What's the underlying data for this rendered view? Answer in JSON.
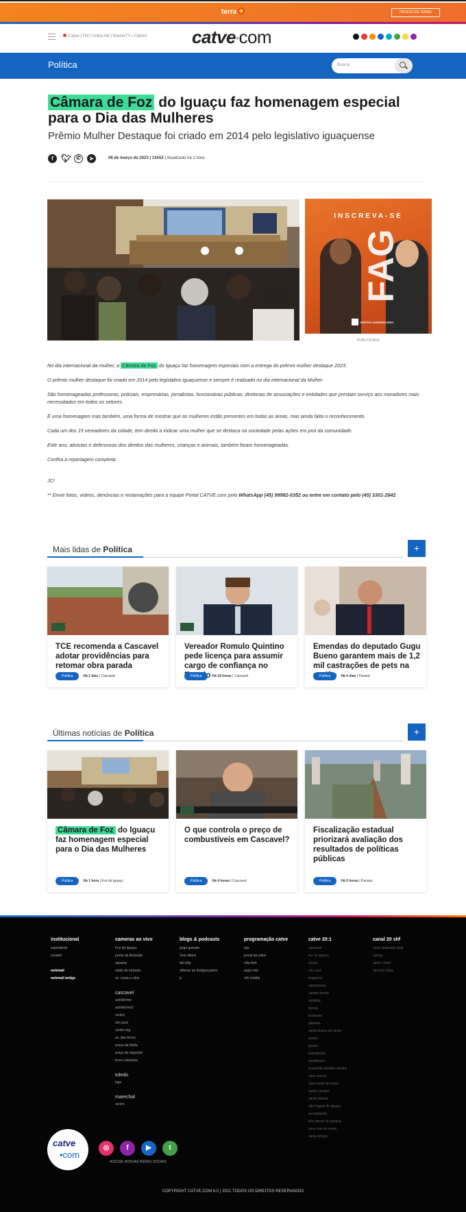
{
  "terra": {
    "logo": "terra",
    "button": "PRODUTOS TERRA"
  },
  "header": {
    "nav_links": "Catve | FM | Unika AM | MasterTV | Catve2",
    "brand_main": "catve",
    "brand_dot": "◦",
    "brand_com": "com",
    "dot_colors": [
      "#111111",
      "#e53935",
      "#fb8c00",
      "#1565c0",
      "#00acc1",
      "#43a047",
      "#fdd835",
      "#8e24aa"
    ]
  },
  "section": {
    "title": "Política",
    "search_placeholder": "Busca"
  },
  "article": {
    "title_hl": "Câmara de Foz",
    "title_rest": " do Iguaçu faz homenagem especial para o Dia das Mulheres",
    "subtitle": "Prêmio Mulher Destaque foi criado em 2014 pelo legislativo iguaçuense",
    "date": "08 de março de 2023 | 13h53",
    "updated": " | Atualizado há 1 hora",
    "share_icons": [
      "facebook-icon",
      "twitter-icon",
      "whatsapp-icon",
      "telegram-icon"
    ]
  },
  "ad": {
    "title": "INSCREVA-SE",
    "big": "FAG",
    "badge": "CENTRO UNIVERSITÁRIO",
    "label": "PUBLICIDADE"
  },
  "body": {
    "p1_pre": "No dia internacional da mulher, a ",
    "p1_hl": "Câmara de Foz",
    "p1_post": " do Iguaçu faz homenagem especiais com a entrega do prêmio mulher destaque 2023.",
    "p2": "O prêmio mulher destaque foi criado em 2014 pelo legislativo iguaçuense e sempre é realizado no dia internacional da Mulher.",
    "p3": "São homenageadas professoras, policiais, empresárias, jornalistas, funcionárias públicas, diretorias de associações e entidades que prestam serviço aos moradores mais necessitados em todos os setores.",
    "p4": "É uma homenagem mas também, uma forma de mostrar que as mulheres estão presentes em todas as áreas, mas ainda falta o reconhecimento.",
    "p5": "Cada um dos 15 vereadores da cidade, tem direito a indicar uma mulher que se destaca na sociedade pelas ações em prol da comunidade.",
    "p6": "Este ano, ativistas e defensoras dos direitos das mulheres, crianças e animais, também foram homenageadas.",
    "p7": "Confira a reportagem completa:",
    "p8": "JC!",
    "p9_pre": "** Envie fotos, vídeos, denúncias e reclamações para a equipe Portal CATVE.com pelo ",
    "p9_strong": "WhatsApp (45) 99982-0352 ou entre em contato pelo (45) 3301-2642"
  },
  "mais_lidas": {
    "label_pre": "Mais lidas de ",
    "label_bold": "Política",
    "plus": "+",
    "cards": [
      {
        "title": "TCE recomenda a Cascavel adotar providências para retomar obra parada",
        "pill": "Política",
        "time": "Há 2 dias",
        "place": " | Cascavel"
      },
      {
        "title": "Vereador Romulo Quintino pede licença para assumir cargo de confiança no Estado",
        "pill": "Política",
        "time": "Há 18 horas",
        "place": " | Cascavel"
      },
      {
        "title": "Emendas do deputado Gugu Bueno garantem mais de 1,2 mil castrações de pets na região",
        "pill": "Política",
        "time": "Há 4 dias",
        "place": " | Paraná"
      }
    ]
  },
  "ultimas": {
    "label_pre": "Últimas notícias de ",
    "label_bold": "Política",
    "plus": "+",
    "cards": [
      {
        "title_hl": "Câmara de Foz",
        "title": " do Iguaçu faz homenagem especial para o Dia das Mulheres",
        "pill": "Política",
        "time": "Há 1 hora",
        "place": " | Foz do Iguaçu"
      },
      {
        "title": "O que controla o preço de combustíveis em Cascavel?",
        "pill": "Política",
        "time": "Há 4 horas",
        "place": " | Cascavel"
      },
      {
        "title": "Fiscalização estadual priorizará avaliação dos resultados de políticas públicas",
        "pill": "Política",
        "time": "Há 5 horas",
        "place": " | Paraná"
      }
    ]
  },
  "footer": {
    "col1": {
      "h": "institucional",
      "items": [
        "expediente",
        "contato"
      ],
      "bold": [
        "webmail",
        "webmail antigo"
      ]
    },
    "col2": {
      "h": "cameras ao vivo",
      "items": [
        "Foz do Iguaçu",
        "ponte da Amizade",
        "aduana",
        "visão de entrada",
        "av. costa e silva"
      ],
      "sub1": "cascavel",
      "items2": [
        "autódromo",
        "autódromo2",
        "centro",
        "céu azul",
        "centro tug",
        "av. das torres",
        "praça da bíblia",
        "praça do migrante",
        "trevo cataratas"
      ],
      "sub2": "toledo",
      "items3": [
        "lago"
      ],
      "sub3": "marechal",
      "items4": [
        "centro"
      ]
    },
    "col3": {
      "h": "blogs & podcasts",
      "items": [
        "jorge guirado",
        "One attack",
        "tati lolly",
        "offense ao hodgonçalves",
        "jc"
      ]
    },
    "col4": {
      "h": "programação catve",
      "items": [
        "epc",
        "jornal da catve",
        "vika feet",
        "papo reto",
        "orb moldia"
      ]
    },
    "col5": {
      "h": "catve 20:1",
      "items": [
        "cascavel",
        "foz do iguaçu",
        "toledo",
        "céu azul",
        "braganey",
        "catanduvas",
        "campo bonito",
        "corbélia",
        "ibema",
        "lindoeste",
        "palotina",
        "santa tereza do oeste",
        "anahy",
        "iguatu",
        "matelândia",
        "medianeira",
        "marechal cândido rondon",
        "nova aurora",
        "ouro verde do oeste",
        "quatro pontes",
        "santa helena",
        "são miguel do iguaçu",
        "serranópolis",
        "três barras do paraná",
        "vera cruz do oeste",
        "santa tereza"
      ]
    },
    "col6": {
      "h": "canal 20 shf",
      "items": [
        "nova chamada sinal",
        "cantos",
        "santo rafael",
        "nervoso fotos"
      ]
    },
    "logo_top": "catve",
    "logo_bottom": "•com",
    "social_icons": [
      {
        "name": "instagram-icon",
        "glyph": "◎",
        "color": "#e1306c"
      },
      {
        "name": "facebook-icon",
        "glyph": "f",
        "color": "#8e24aa"
      },
      {
        "name": "youtube-icon",
        "glyph": "▶",
        "color": "#1565c0"
      },
      {
        "name": "twitter-icon",
        "glyph": "t",
        "color": "#43a047"
      }
    ],
    "social_label": "ACESSE NOSSAS REDES SOCIAIS",
    "copyright": "COPYRIGHT CATVE.COM 6.0 | 2021 TODOS OS DIREITOS RESERVADOS"
  }
}
